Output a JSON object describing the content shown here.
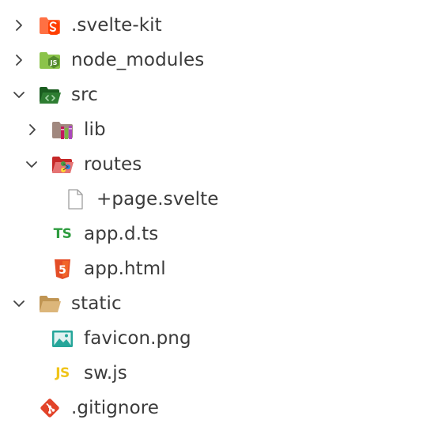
{
  "explorer": {
    "items": [
      {
        "label": ".svelte-kit",
        "icon": "svelte-folder-icon",
        "expanded": false,
        "depth": 0
      },
      {
        "label": "node_modules",
        "icon": "node-folder-icon",
        "expanded": false,
        "depth": 0
      },
      {
        "label": "src",
        "icon": "src-folder-icon",
        "expanded": true,
        "depth": 0
      },
      {
        "label": "lib",
        "icon": "lib-folder-icon",
        "expanded": false,
        "depth": 1
      },
      {
        "label": "routes",
        "icon": "routes-folder-icon",
        "expanded": true,
        "depth": 1
      },
      {
        "label": "+page.svelte",
        "icon": "file-icon",
        "depth": 2
      },
      {
        "label": "app.d.ts",
        "icon": "typescript-icon",
        "icon_text": "TS",
        "depth": 1
      },
      {
        "label": "app.html",
        "icon": "html5-icon",
        "icon_text": "5",
        "depth": 1
      },
      {
        "label": "static",
        "icon": "folder-open-icon",
        "expanded": true,
        "depth": 0
      },
      {
        "label": "favicon.png",
        "icon": "image-icon",
        "depth": 1
      },
      {
        "label": "sw.js",
        "icon": "javascript-icon",
        "icon_text": "JS",
        "depth": 1
      },
      {
        "label": ".gitignore",
        "icon": "git-icon",
        "depth": 0
      }
    ]
  },
  "colors": {
    "text": "#3b3b3b",
    "chevron": "#424242",
    "svelte": "#ff5a30",
    "node": "#7cb342",
    "src_folder": "#2e7d32",
    "typescript": "#2e9c3f",
    "html5": "#e44d26",
    "static_folder": "#dcb67a",
    "image": "#26a69a",
    "javascript": "#f0c419",
    "git": "#e24329"
  }
}
